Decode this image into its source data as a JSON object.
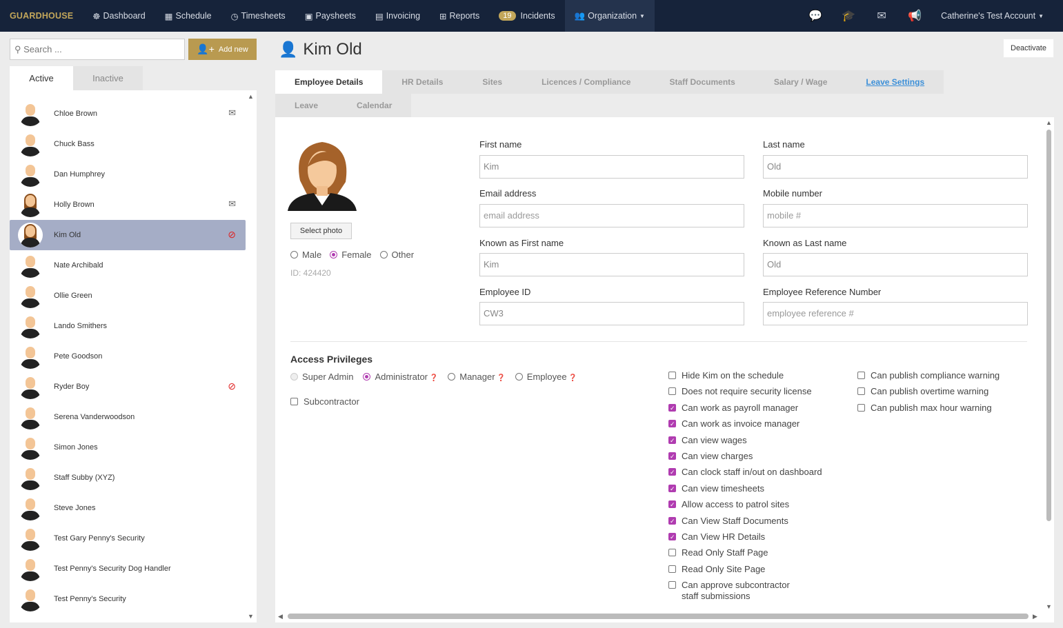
{
  "nav": {
    "logo": "GUARDHOUSE",
    "items": [
      {
        "icon": "☸",
        "label": "Dashboard"
      },
      {
        "icon": "▦",
        "label": "Schedule"
      },
      {
        "icon": "◷",
        "label": "Timesheets"
      },
      {
        "icon": "▣",
        "label": "Paysheets"
      },
      {
        "icon": "▤",
        "label": "Invoicing"
      },
      {
        "icon": "⊞",
        "label": "Reports"
      }
    ],
    "incidents_count": "19",
    "incidents_label": "Incidents",
    "organization_label": "Organization",
    "account_label": "Catherine's Test Account"
  },
  "sidebar": {
    "search_placeholder": "Search ...",
    "add_new": "Add new",
    "tab_active": "Active",
    "tab_inactive": "Inactive",
    "employees": [
      {
        "name": "Chloe Brown",
        "female": false,
        "icon": "mail"
      },
      {
        "name": "Chuck Bass",
        "female": false,
        "icon": ""
      },
      {
        "name": "Dan Humphrey",
        "female": false,
        "icon": ""
      },
      {
        "name": "Holly Brown",
        "female": true,
        "icon": "mail"
      },
      {
        "name": "Kim Old",
        "female": true,
        "icon": "ban",
        "selected": true
      },
      {
        "name": "Nate Archibald",
        "female": false,
        "icon": ""
      },
      {
        "name": "Ollie Green",
        "female": false,
        "icon": ""
      },
      {
        "name": "Lando Smithers",
        "female": false,
        "icon": ""
      },
      {
        "name": "Pete Goodson",
        "female": false,
        "icon": ""
      },
      {
        "name": "Ryder Boy",
        "female": false,
        "icon": "ban"
      },
      {
        "name": "Serena Vanderwoodson",
        "female": false,
        "icon": ""
      },
      {
        "name": "Simon Jones",
        "female": false,
        "icon": ""
      },
      {
        "name": "Staff Subby (XYZ)",
        "female": false,
        "icon": ""
      },
      {
        "name": "Steve Jones",
        "female": false,
        "icon": ""
      },
      {
        "name": "Test Gary Penny's Security",
        "female": false,
        "icon": ""
      },
      {
        "name": "Test Penny's Security Dog Handler",
        "female": false,
        "icon": ""
      },
      {
        "name": "Test Penny's Security",
        "female": false,
        "icon": ""
      }
    ]
  },
  "page": {
    "title": "Kim Old",
    "deactivate": "Deactivate",
    "tabs": [
      "Employee Details",
      "HR Details",
      "Sites",
      "Licences / Compliance",
      "Staff Documents",
      "Salary / Wage",
      "Leave Settings",
      "Leave",
      "Calendar"
    ]
  },
  "form": {
    "select_photo": "Select photo",
    "gender": [
      "Male",
      "Female",
      "Other"
    ],
    "gender_selected": "Female",
    "id_text": "ID: 424420",
    "first_name_label": "First name",
    "first_name": "Kim",
    "last_name_label": "Last name",
    "last_name": "Old",
    "email_label": "Email address",
    "email_placeholder": "email address",
    "mobile_label": "Mobile number",
    "mobile_placeholder": "mobile #",
    "known_first_label": "Known as First name",
    "known_first": "Kim",
    "known_last_label": "Known as Last name",
    "known_last": "Old",
    "employee_id_label": "Employee ID",
    "employee_id": "CW3",
    "ref_label": "Employee Reference Number",
    "ref_placeholder": "employee reference #"
  },
  "access": {
    "title": "Access Privileges",
    "roles": [
      "Super Admin",
      "Administrator",
      "Manager",
      "Employee"
    ],
    "role_selected": "Administrator",
    "subcontractor": "Subcontractor",
    "col1": [
      {
        "label": "Hide Kim on the schedule",
        "checked": false
      },
      {
        "label": "Does not require security license",
        "checked": false
      },
      {
        "label": "Can work as payroll manager",
        "checked": true
      },
      {
        "label": "Can work as invoice manager",
        "checked": true
      },
      {
        "label": "Can view wages",
        "checked": true
      },
      {
        "label": "Can view charges",
        "checked": true
      },
      {
        "label": "Can clock staff in/out on dashboard",
        "checked": true
      },
      {
        "label": "Can view timesheets",
        "checked": true
      },
      {
        "label": "Allow access to patrol sites",
        "checked": true
      },
      {
        "label": "Can View Staff Documents",
        "checked": true
      },
      {
        "label": "Can View HR Details",
        "checked": true
      },
      {
        "label": "Read Only Staff Page",
        "checked": false
      },
      {
        "label": "Read Only Site Page",
        "checked": false
      },
      {
        "label": "Can approve subcontractor staff submissions",
        "checked": false
      }
    ],
    "col2": [
      {
        "label": "Can publish compliance warning",
        "checked": false
      },
      {
        "label": "Can publish overtime warning",
        "checked": false
      },
      {
        "label": "Can publish max hour warning",
        "checked": false
      }
    ]
  }
}
